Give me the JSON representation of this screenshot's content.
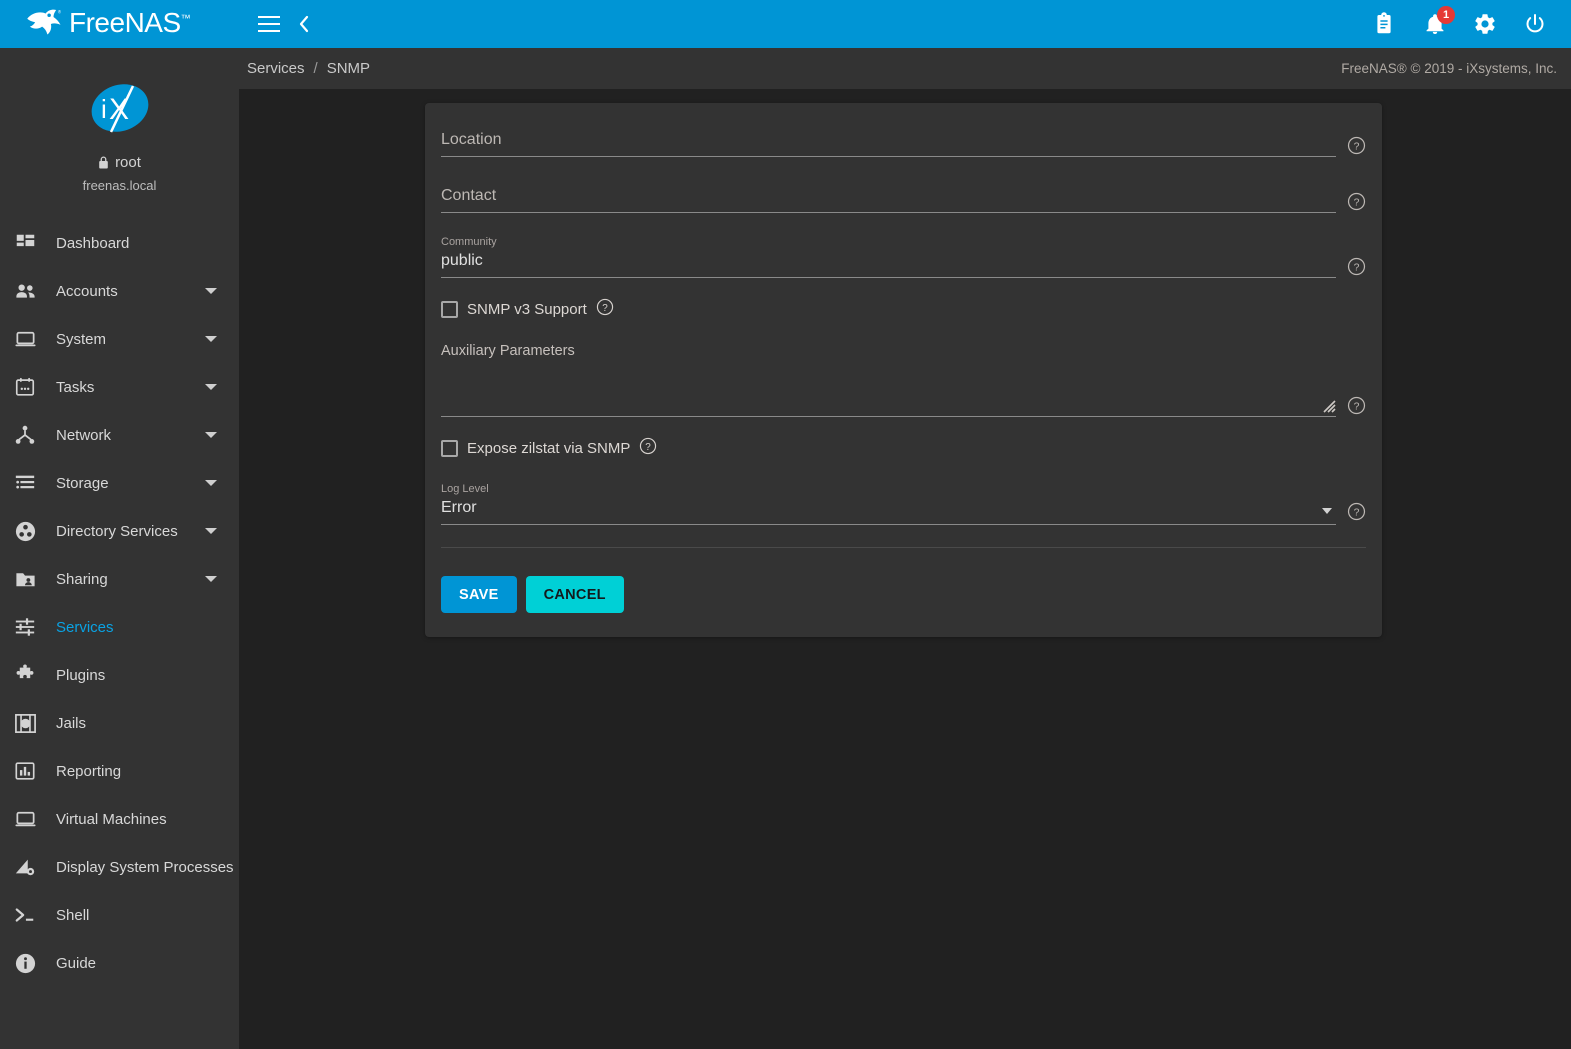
{
  "brand": {
    "name": "FreeNAS",
    "trademark": "™",
    "logo_icon": "freenas-fish-logo"
  },
  "topbar": {
    "menu_icon": "hamburger-menu-icon",
    "back_icon": "chevron-left-icon",
    "actions": [
      {
        "name": "clipboard-icon",
        "label": "Tasks"
      },
      {
        "name": "bell-icon",
        "label": "Alerts",
        "badge": "1"
      },
      {
        "name": "gear-icon",
        "label": "Settings"
      },
      {
        "name": "power-icon",
        "label": "Power"
      }
    ]
  },
  "sidebar": {
    "avatar_icon": "ix-systems-logo",
    "lock_icon": "lock-icon",
    "username": "root",
    "hostname": "freenas.local",
    "items": [
      {
        "label": "Dashboard",
        "icon": "dashboard-icon",
        "expandable": false,
        "active": false
      },
      {
        "label": "Accounts",
        "icon": "accounts-people-icon",
        "expandable": true,
        "active": false
      },
      {
        "label": "System",
        "icon": "system-laptop-icon",
        "expandable": true,
        "active": false
      },
      {
        "label": "Tasks",
        "icon": "tasks-calendar-icon",
        "expandable": true,
        "active": false
      },
      {
        "label": "Network",
        "icon": "network-node-icon",
        "expandable": true,
        "active": false
      },
      {
        "label": "Storage",
        "icon": "storage-list-icon",
        "expandable": true,
        "active": false
      },
      {
        "label": "Directory Services",
        "icon": "directory-services-disc-icon",
        "expandable": true,
        "active": false
      },
      {
        "label": "Sharing",
        "icon": "sharing-folder-icon",
        "expandable": true,
        "active": false
      },
      {
        "label": "Services",
        "icon": "services-sliders-icon",
        "expandable": false,
        "active": true
      },
      {
        "label": "Plugins",
        "icon": "plugins-puzzle-icon",
        "expandable": false,
        "active": false
      },
      {
        "label": "Jails",
        "icon": "jails-icon",
        "expandable": false,
        "active": false
      },
      {
        "label": "Reporting",
        "icon": "reporting-chart-icon",
        "expandable": false,
        "active": false
      },
      {
        "label": "Virtual Machines",
        "icon": "virtual-machines-monitor-icon",
        "expandable": false,
        "active": false
      },
      {
        "label": "Display System Processes",
        "icon": "processes-icon",
        "expandable": false,
        "active": false
      },
      {
        "label": "Shell",
        "icon": "shell-prompt-icon",
        "expandable": false,
        "active": false
      },
      {
        "label": "Guide",
        "icon": "guide-info-icon",
        "expandable": false,
        "active": false
      }
    ]
  },
  "breadcrumb": {
    "root": "Services",
    "separator": "/",
    "current": "SNMP"
  },
  "footer": {
    "copyright": "FreeNAS® © 2019 - iXsystems, Inc."
  },
  "form": {
    "location": {
      "label": "Location",
      "value": "",
      "placeholder": "Location",
      "help_icon": "help-circle-icon"
    },
    "contact": {
      "label": "Contact",
      "value": "",
      "placeholder": "Contact",
      "help_icon": "help-circle-icon"
    },
    "community": {
      "label": "Community",
      "value": "public",
      "placeholder": "",
      "help_icon": "help-circle-icon"
    },
    "snmp_v3": {
      "label": "SNMP v3 Support",
      "checked": false,
      "help_icon": "help-circle-icon"
    },
    "auxiliary_parameters": {
      "label": "Auxiliary Parameters",
      "value": "",
      "help_icon": "help-circle-icon",
      "resize_icon": "resize-grip-icon"
    },
    "expose_zilstat": {
      "label": "Expose zilstat via SNMP",
      "checked": false,
      "help_icon": "help-circle-icon"
    },
    "log_level": {
      "label": "Log Level",
      "value": "Error",
      "help_icon": "help-circle-icon",
      "arrow_icon": "chevron-down-icon"
    },
    "save_label": "SAVE",
    "cancel_label": "CANCEL"
  },
  "colors": {
    "accent_blue": "#0095d5",
    "accent_cyan": "#00d0d6",
    "badge_red": "#e53935",
    "sidebar_bg": "#333333",
    "page_bg": "#212121",
    "active_link": "#0aa2e3"
  }
}
